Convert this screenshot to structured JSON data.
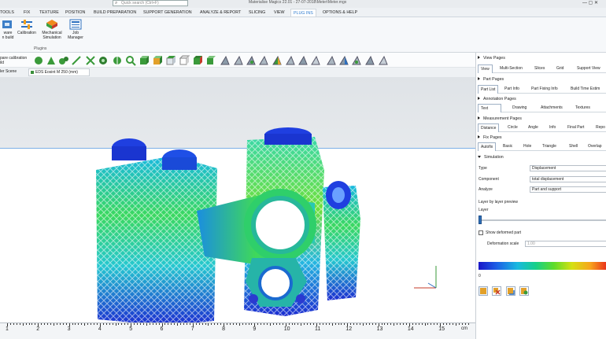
{
  "titlebar": {
    "search_placeholder": "Quick search (Ctrl+F)",
    "title": "Materialise Magics 22.01 - 27-07-2018\\Meter\\Meter.mgx",
    "controls": "—  ▢  ✕"
  },
  "ribbon_tabs": [
    "TOOLS",
    "FIX",
    "TEXTURE",
    "POSITION",
    "BUILD PREPARATION",
    "SUPPORT GENERATION",
    "ANALYZE & REPORT",
    "SLICING",
    "VIEW",
    "PLUG INS",
    "OPTIONS & HELP"
  ],
  "active_tab": "PLUG INS",
  "ribbon": {
    "buttons": [
      {
        "label1": "ware",
        "label2": "n build",
        "icon": "build-icon"
      },
      {
        "label1": "Calibration",
        "label2": "",
        "icon": "calibration-icon"
      },
      {
        "label1": "Mechanical",
        "label2": "Simulation",
        "icon": "mechanical-simulation-icon"
      },
      {
        "label1": "Job",
        "label2": "Manager",
        "icon": "job-manager-icon"
      }
    ],
    "group_label": "Plugins"
  },
  "toolbar_left": {
    "line1": "pare calibration",
    "line2": "ild"
  },
  "scene": {
    "left_label": "ler Scene",
    "tab_label": "EDS Eosint M 250 (mm)"
  },
  "ruler": {
    "labels": [
      "1",
      "2",
      "3",
      "4",
      "5",
      "6",
      "7",
      "8",
      "9",
      "10",
      "11",
      "12",
      "13",
      "14",
      "15"
    ],
    "unit": "cm"
  },
  "panel": {
    "view_pages": {
      "title": "View Pages",
      "tabs": [
        "View",
        "Multi-Section",
        "Slices",
        "Grid",
        "Support View"
      ]
    },
    "part_pages": {
      "title": "Part Pages",
      "tabs": [
        "Part List",
        "Part Info",
        "Part Fixing Info",
        "Build Time Estim"
      ]
    },
    "annotation_pages": {
      "title": "Annotation Pages",
      "tabs": [
        "Text",
        "Drawing",
        "Attachments",
        "Textures"
      ]
    },
    "measurement_pages": {
      "title": "Measurement Pages",
      "tabs": [
        "Distance",
        "Circle",
        "Angle",
        "Info",
        "Final Part",
        "Repo"
      ]
    },
    "fix_pages": {
      "title": "Fix Pages",
      "tabs": [
        "Autofix",
        "Basic",
        "Hole",
        "Triangle",
        "Shell",
        "Overlap"
      ]
    },
    "simulation": {
      "title": "Simulation",
      "type_label": "Type",
      "type_value": "Displacement",
      "component_label": "Component",
      "component_value": "total displacement",
      "analyze_label": "Analyze",
      "analyze_value": "Part and support",
      "layer_preview_label": "Layer by layer preview",
      "layer_label": "Layer",
      "show_deformed_label": "Show deformed part",
      "deformation_scale_label": "Deformation scale",
      "deformation_scale_value": "1.00",
      "scale_min": "0"
    }
  }
}
